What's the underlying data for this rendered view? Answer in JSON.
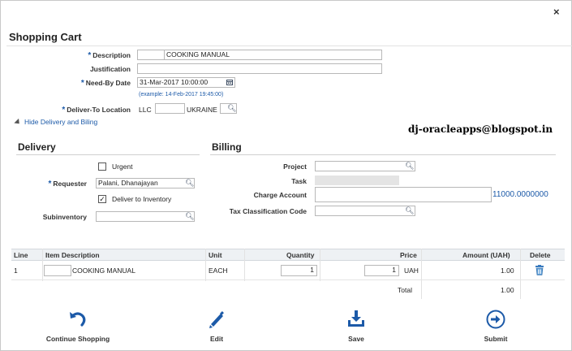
{
  "dialog": {
    "close_glyph": "×"
  },
  "header": {
    "title": "Shopping Cart"
  },
  "form": {
    "description_label": "Description",
    "description_value": "COOKING MANUAL",
    "justification_label": "Justification",
    "justification_value": "",
    "need_by_label": "Need-By Date",
    "need_by_value": "31-Mar-2017 10:00:00",
    "need_by_hint": "(example: 14-Feb-2017 19:45:00)",
    "deliver_to_label": "Deliver-To Location",
    "deliver_to_prefix": "LLC",
    "deliver_to_value": "UKRAINE",
    "disclose_link": "Hide Delivery and Biling"
  },
  "watermark": "dj-oracleapps@blogspot.in",
  "delivery": {
    "heading": "Delivery",
    "urgent_label": "Urgent",
    "urgent_checked": "",
    "requester_label": "Requester",
    "requester_value": "Palani, Dhanajayan",
    "deliver_inventory_label": "Deliver to Inventory",
    "deliver_inventory_checked": "✓",
    "subinventory_label": "Subinventory",
    "subinventory_value": ""
  },
  "billing": {
    "heading": "Billing",
    "project_label": "Project",
    "project_value": "",
    "task_label": "Task",
    "charge_account_label": "Charge Account",
    "charge_account_value": "",
    "charge_account_link": "11000.0000000",
    "tax_label": "Tax Classification Code",
    "tax_value": ""
  },
  "table": {
    "headers": {
      "line": "Line",
      "item": "Item Description",
      "unit": "Unit",
      "quantity": "Quantity",
      "price": "Price",
      "amount": "Amount (UAH)",
      "delete": "Delete"
    },
    "rows": [
      {
        "line": "1",
        "item": "COOKING MANUAL",
        "unit": "EACH",
        "quantity": "1",
        "price": "1",
        "currency": "UAH",
        "amount": "1.00"
      }
    ],
    "total_label": "Total",
    "total_value": "1.00"
  },
  "actions": {
    "continue_label": "Continue Shopping",
    "edit_label": "Edit",
    "save_label": "Save",
    "submit_label": "Submit"
  },
  "colors": {
    "accent": "#1c5aa8",
    "required": "#1c5aa8",
    "link": "#1c5aa8"
  },
  "icons": {
    "close": "close-icon",
    "lov": "search-icon",
    "calendar": "calendar-icon",
    "delete": "trash-icon",
    "continue": "undo-arrow-icon",
    "edit": "pencil-icon",
    "save": "download-tray-icon",
    "submit": "arrow-circle-icon"
  }
}
